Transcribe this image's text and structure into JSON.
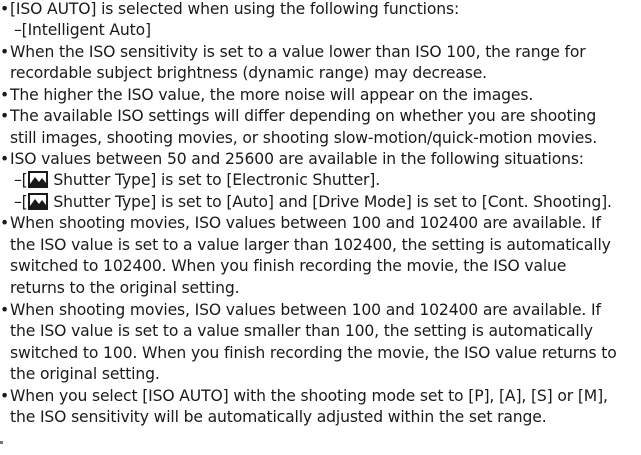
{
  "notes": [
    {
      "id": "n1",
      "lines": [
        "[ISO AUTO] is selected when using the following functions:"
      ]
    },
    {
      "id": "n1s1",
      "lines": [
        "–[Intelligent Auto]"
      ]
    },
    {
      "id": "n2",
      "lines": [
        "When the ISO sensitivity is set to a value lower than ISO 100, the range for",
        "recordable subject brightness (dynamic range) may decrease."
      ]
    },
    {
      "id": "n3",
      "lines": [
        "The higher the ISO value, the more noise will appear on the images."
      ]
    },
    {
      "id": "n4",
      "lines": [
        "The available ISO settings will differ depending on whether you are shooting",
        "still images, shooting movies, or shooting slow-motion/quick-motion movies."
      ]
    },
    {
      "id": "n5",
      "lines": [
        "ISO values between 50 and 25600 are available in the following situations:"
      ]
    },
    {
      "id": "n5s1",
      "prefix": "–[",
      "rest": " Shutter Type] is set to [Electronic Shutter]."
    },
    {
      "id": "n5s2",
      "prefix": "–[",
      "rest": " Shutter Type] is set to [Auto] and [Drive Mode] is set to [Cont. Shooting]."
    },
    {
      "id": "n6",
      "lines": [
        "When shooting movies, ISO values between 100 and 102400 are available. If",
        "the ISO value is set to a value larger than 102400, the setting is automatically",
        "switched to 102400. When you finish recording the movie, the ISO value",
        "returns to the original setting."
      ]
    },
    {
      "id": "n7",
      "lines": [
        "When shooting movies, ISO values between 100 and 102400 are available. If",
        "the ISO value is set to a value smaller than 100, the setting is automatically",
        "switched to 100. When you finish recording the movie, the ISO value returns to",
        "the original setting."
      ]
    },
    {
      "id": "n8",
      "lines": [
        "When you select [ISO AUTO] with the shooting mode set to [P], [A], [S] or [M],",
        "the ISO sensitivity will be automatically adjusted within the set range."
      ]
    }
  ],
  "bullet_char": "•",
  "icons": {
    "still_image_icon": "camera-still-image-icon"
  }
}
